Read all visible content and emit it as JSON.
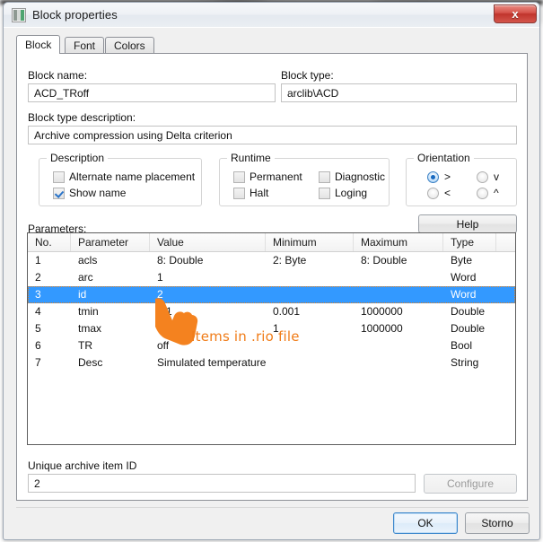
{
  "window": {
    "title": "Block properties",
    "icon": "block-properties-icon",
    "close_label": "x"
  },
  "tabs": [
    {
      "label": "Block",
      "active": true
    },
    {
      "label": "Font",
      "active": false
    },
    {
      "label": "Colors",
      "active": false
    }
  ],
  "fields": {
    "block_name_label": "Block name:",
    "block_name_value": "ACD_TRoff",
    "block_type_label": "Block type:",
    "block_type_value": "arclib\\ACD",
    "block_type_description_label": "Block type description:",
    "block_type_description_value": "Archive compression using Delta criterion",
    "unique_id_label": "Unique archive item ID",
    "unique_id_value": "2"
  },
  "description_group": {
    "title": "Description",
    "items": [
      {
        "label": "Alternate name placement",
        "checked": false
      },
      {
        "label": "Show name",
        "checked": true
      }
    ]
  },
  "runtime_group": {
    "title": "Runtime",
    "items": [
      {
        "label": "Permanent",
        "checked": false
      },
      {
        "label": "Diagnostic",
        "checked": false
      },
      {
        "label": "Halt",
        "checked": false
      },
      {
        "label": "Loging",
        "checked": false
      }
    ]
  },
  "orientation_group": {
    "title": "Orientation",
    "items": [
      {
        "label": ">",
        "selected": true
      },
      {
        "label": "v",
        "selected": false
      },
      {
        "label": "<",
        "selected": false
      },
      {
        "label": "^",
        "selected": false
      }
    ]
  },
  "parameters": {
    "label": "Parameters:",
    "help_label": "Help",
    "columns": [
      "No.",
      "Parameter",
      "Value",
      "Minimum",
      "Maximum",
      "Type",
      ""
    ],
    "rows": [
      {
        "no": "1",
        "parameter": "acls",
        "value": "8: Double",
        "minimum": "2: Byte",
        "maximum": "8: Double",
        "type": "Byte",
        "selected": false
      },
      {
        "no": "2",
        "parameter": "arc",
        "value": "1",
        "minimum": "",
        "maximum": "",
        "type": "Word",
        "selected": false
      },
      {
        "no": "3",
        "parameter": "id",
        "value": "2",
        "minimum": "",
        "maximum": "",
        "type": "Word",
        "selected": true
      },
      {
        "no": "4",
        "parameter": "tmin",
        "value": "0.1",
        "minimum": "0.001",
        "maximum": "1000000",
        "type": "Double",
        "selected": false
      },
      {
        "no": "5",
        "parameter": "tmax",
        "value": "5",
        "minimum": "1",
        "maximum": "1000000",
        "type": "Double",
        "selected": false
      },
      {
        "no": "6",
        "parameter": "TR",
        "value": "off",
        "minimum": "",
        "maximum": "",
        "type": "Bool",
        "selected": false
      },
      {
        "no": "7",
        "parameter": "Desc",
        "value": "Simulated temperature ...",
        "minimum": "",
        "maximum": "",
        "type": "String",
        "selected": false
      }
    ]
  },
  "buttons": {
    "configure": "Configure",
    "ok": "OK",
    "cancel": "Storno"
  },
  "annotation": {
    "text": "Items in .rio file",
    "color": "#f07c18",
    "cursor": "hand-pointer-cursor"
  },
  "colors": {
    "selection": "#3399ff",
    "accent": "#f07c18",
    "dialog_bg": "#f0f0f0",
    "page_bg": "#ffffff"
  }
}
